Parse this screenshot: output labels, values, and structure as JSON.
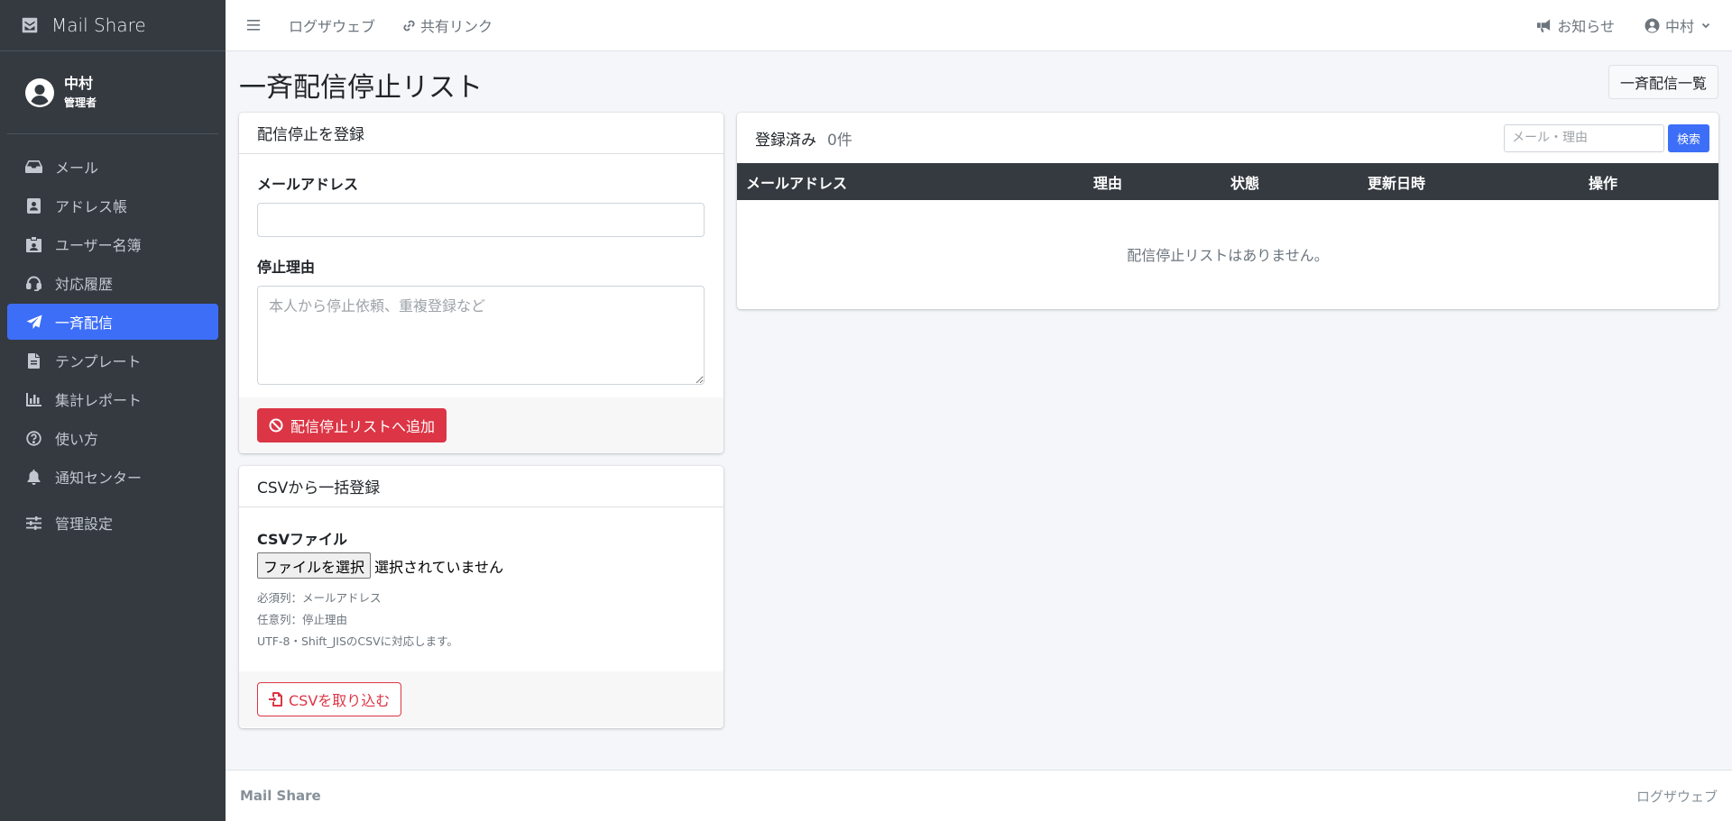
{
  "brand": {
    "name": "Mail Share",
    "icon": "envelope-box-icon"
  },
  "user": {
    "name": "中村",
    "role": "管理者"
  },
  "sidebar": {
    "items": [
      {
        "label": "メール",
        "icon": "inbox-icon"
      },
      {
        "label": "アドレス帳",
        "icon": "address-book-icon"
      },
      {
        "label": "ユーザー名簿",
        "icon": "id-badge-icon"
      },
      {
        "label": "対応履歴",
        "icon": "headset-icon"
      },
      {
        "label": "一斉配信",
        "icon": "paper-plane-icon",
        "active": true
      },
      {
        "label": "テンプレート",
        "icon": "file-icon"
      },
      {
        "label": "集計レポート",
        "icon": "chart-bar-icon"
      },
      {
        "label": "使い方",
        "icon": "question-circle-icon"
      },
      {
        "label": "通知センター",
        "icon": "bell-icon"
      },
      {
        "label": "管理設定",
        "icon": "sliders-icon"
      }
    ]
  },
  "topbar": {
    "link1": "ログザウェブ",
    "link2": "共有リンク",
    "notice": "お知らせ",
    "user": "中村"
  },
  "page": {
    "title": "一斉配信停止リスト",
    "list_button": "一斉配信一覧"
  },
  "register_card": {
    "header": "配信停止を登録",
    "email_label": "メールアドレス",
    "email_value": "",
    "reason_label": "停止理由",
    "reason_placeholder": "本人から停止依頼、重複登録など",
    "submit": "配信停止リストへ追加"
  },
  "csv_card": {
    "header": "CSVから一括登録",
    "file_label": "CSVファイル",
    "file_button": "ファイルを選択",
    "file_status": "選択されていません",
    "help": [
      "必須列：メールアドレス",
      "任意列：停止理由",
      "UTF-8・Shift_JISのCSVに対応します。"
    ],
    "submit": "CSVを取り込む"
  },
  "list_card": {
    "title": "登録済み",
    "count": "0件",
    "search_placeholder": "メール・理由",
    "search_button": "検索",
    "columns": [
      "メールアドレス",
      "理由",
      "状態",
      "更新日時",
      "操作"
    ],
    "empty": "配信停止リストはありません。"
  },
  "footer": {
    "left": "Mail Share",
    "right": "ログザウェブ"
  },
  "colors": {
    "sidebar_bg": "#343a40",
    "active": "#3d6ef7",
    "danger": "#dc3545"
  }
}
